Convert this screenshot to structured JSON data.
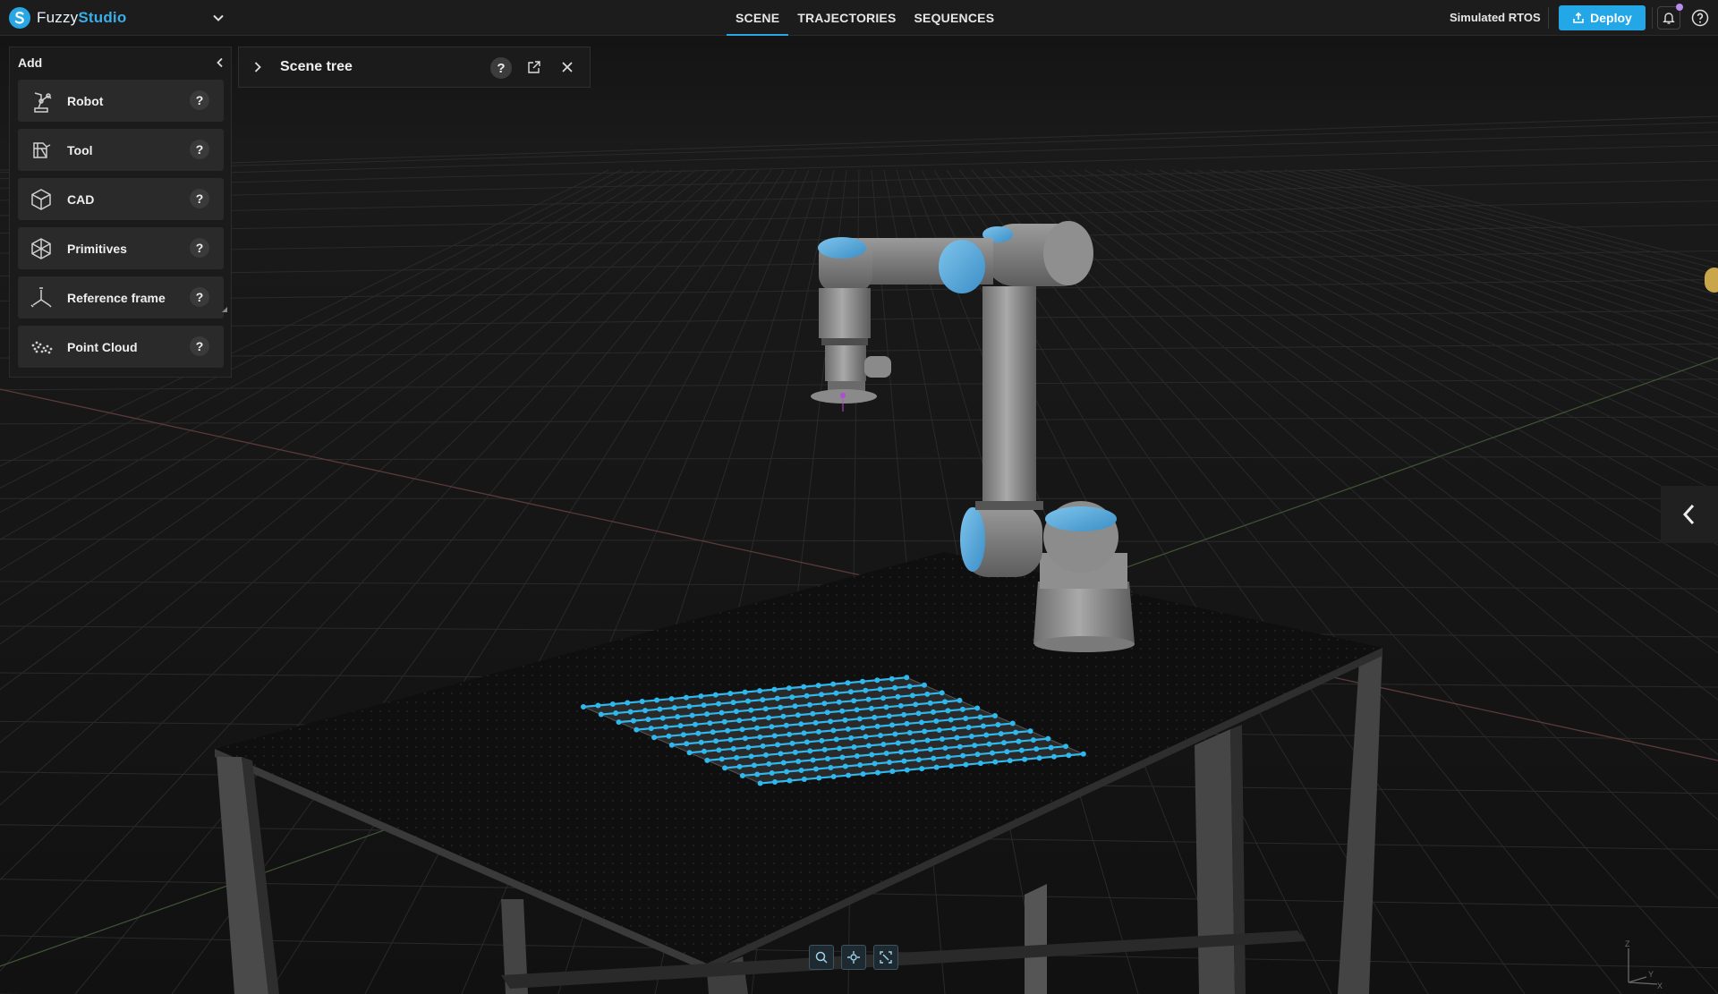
{
  "app": {
    "name_prefix": "Fuzzy",
    "name_suffix": "Studio",
    "logo_icon": "logo-s-icon",
    "menu_icon": "chevron-down-icon"
  },
  "nav": {
    "tabs": [
      {
        "label": "SCENE",
        "active": true
      },
      {
        "label": "TRAJECTORIES",
        "active": false
      },
      {
        "label": "SEQUENCES",
        "active": false
      }
    ]
  },
  "status": {
    "rtos_label": "Simulated RTOS"
  },
  "toolbar": {
    "deploy_label": "Deploy",
    "notification_icon": "bell-icon",
    "help_icon": "help-circle-icon"
  },
  "add_panel": {
    "title": "Add",
    "items": [
      {
        "label": "Robot",
        "icon": "robot-arm-icon",
        "help": "?"
      },
      {
        "label": "Tool",
        "icon": "tool-icon",
        "help": "?"
      },
      {
        "label": "CAD",
        "icon": "cube-icon",
        "help": "?"
      },
      {
        "label": "Primitives",
        "icon": "primitives-icon",
        "help": "?"
      },
      {
        "label": "Reference frame",
        "icon": "axes-icon",
        "help": "?"
      },
      {
        "label": "Point Cloud",
        "icon": "point-cloud-icon",
        "help": "?"
      }
    ]
  },
  "scene_tree": {
    "title": "Scene tree",
    "help": "?"
  },
  "viewport_tools": [
    {
      "name": "zoom-icon"
    },
    {
      "name": "focus-icon"
    },
    {
      "name": "fit-view-icon"
    }
  ],
  "axes_gizmo": {
    "z": "Z",
    "y": "Y",
    "x": "X"
  },
  "colors": {
    "accent": "#23a7e6",
    "background": "#161616",
    "panel": "#1b1b1b",
    "point_cloud": "#2fb8ee"
  }
}
